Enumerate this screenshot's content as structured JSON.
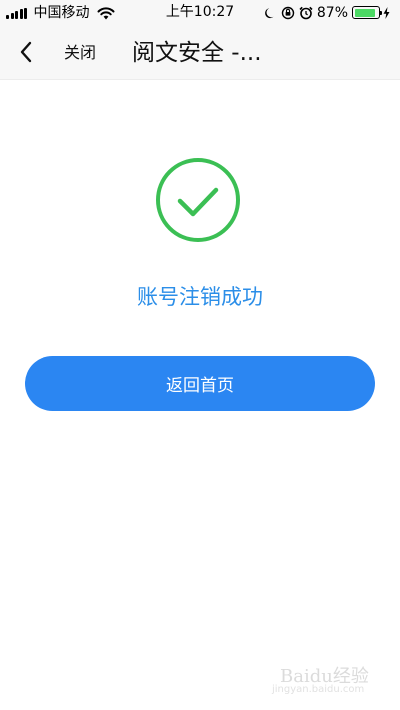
{
  "status_bar": {
    "carrier": "中国移动",
    "time": "上午10:27",
    "battery_percent": "87%",
    "battery_level": 0.87,
    "battery_color": "#4cd964",
    "icons": [
      "signal-icon",
      "wifi-icon",
      "moon-icon",
      "orientation-lock-icon",
      "alarm-icon",
      "battery-icon",
      "charging-icon"
    ]
  },
  "nav": {
    "back_icon": "chevron-left-icon",
    "close_label": "关闭",
    "title": "阅文安全 -..."
  },
  "main": {
    "status_icon": "check-circle-icon",
    "status_icon_color": "#3bbf54",
    "message": "账号注销成功",
    "message_color": "#2b8ee8",
    "button_label": "返回首页",
    "button_color": "#2b86f2"
  },
  "watermark": {
    "logo": "Baidu经验",
    "sub": "jingyan.baidu.com"
  }
}
